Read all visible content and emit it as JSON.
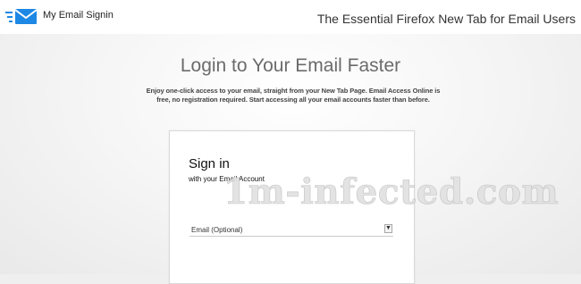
{
  "header": {
    "logo_icon": "envelope-icon",
    "logo_text": "My Email Signin",
    "tagline": "The Essential Firefox New Tab for Email Users"
  },
  "hero": {
    "headline": "Login to Your Email Faster",
    "description": "Enjoy one-click access to your email, straight from your New Tab Page. Email Access Online is free, no registration required. Start accessing all your email accounts faster than before."
  },
  "signin_card": {
    "title": "Sign in",
    "subtitle": "with your Email Account",
    "email_select": {
      "selected": "Email (Optional)",
      "arrow_icon": "chevron-down-icon"
    }
  },
  "watermark": "1m-infected.com",
  "colors": {
    "brand_blue": "#1e88e5",
    "headline_gray": "#6b6b6b"
  }
}
